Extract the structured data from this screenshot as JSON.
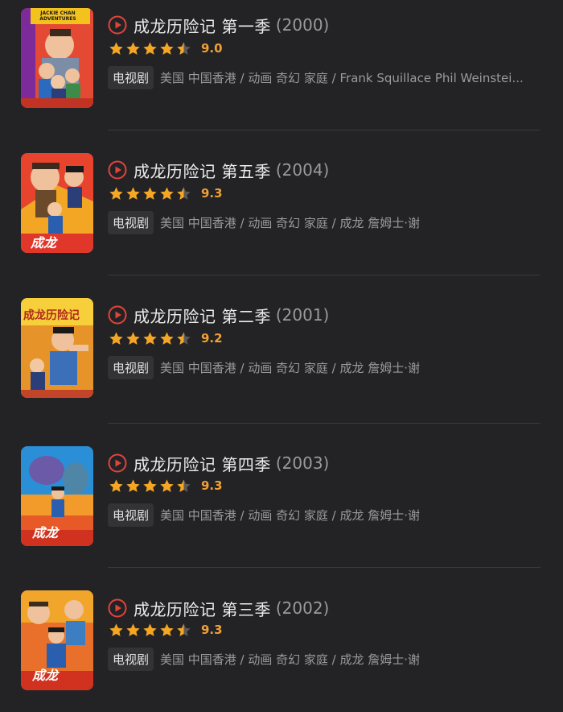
{
  "items": [
    {
      "title": "成龙历险记 第一季",
      "year": "(2000)",
      "score": "9.0",
      "stars_filled": 4.5,
      "tag": "电视剧",
      "meta": "美国 中国香港 / 动画 奇幻 家庭 / Frank Squillace Phil Weinstei...",
      "poster_text": "JACKIE CHAN ADVENTURES"
    },
    {
      "title": "成龙历险记 第五季",
      "year": "(2004)",
      "score": "9.3",
      "stars_filled": 4.5,
      "tag": "电视剧",
      "meta": "美国 中国香港 / 动画 奇幻 家庭 / 成龙 詹姆士·谢",
      "poster_text": "成龙"
    },
    {
      "title": "成龙历险记 第二季",
      "year": "(2001)",
      "score": "9.2",
      "stars_filled": 4.5,
      "tag": "电视剧",
      "meta": "美国 中国香港 / 动画 奇幻 家庭 / 成龙 詹姆士·谢",
      "poster_text": "成龙历险记"
    },
    {
      "title": "成龙历险记 第四季",
      "year": "(2003)",
      "score": "9.3",
      "stars_filled": 4.5,
      "tag": "电视剧",
      "meta": "美国 中国香港 / 动画 奇幻 家庭 / 成龙 詹姆士·谢",
      "poster_text": "成龙"
    },
    {
      "title": "成龙历险记 第三季",
      "year": "(2002)",
      "score": "9.3",
      "stars_filled": 4.5,
      "tag": "电视剧",
      "meta": "美国 中国香港 / 动画 奇幻 家庭 / 成龙 詹姆士·谢",
      "poster_text": "成龙"
    }
  ],
  "colors": {
    "background": "#232326",
    "play_icon": "#e0443a",
    "star": "#f5a623",
    "star_empty": "#5a5a5a",
    "score": "#f0a035",
    "tag_bg": "#333336"
  }
}
